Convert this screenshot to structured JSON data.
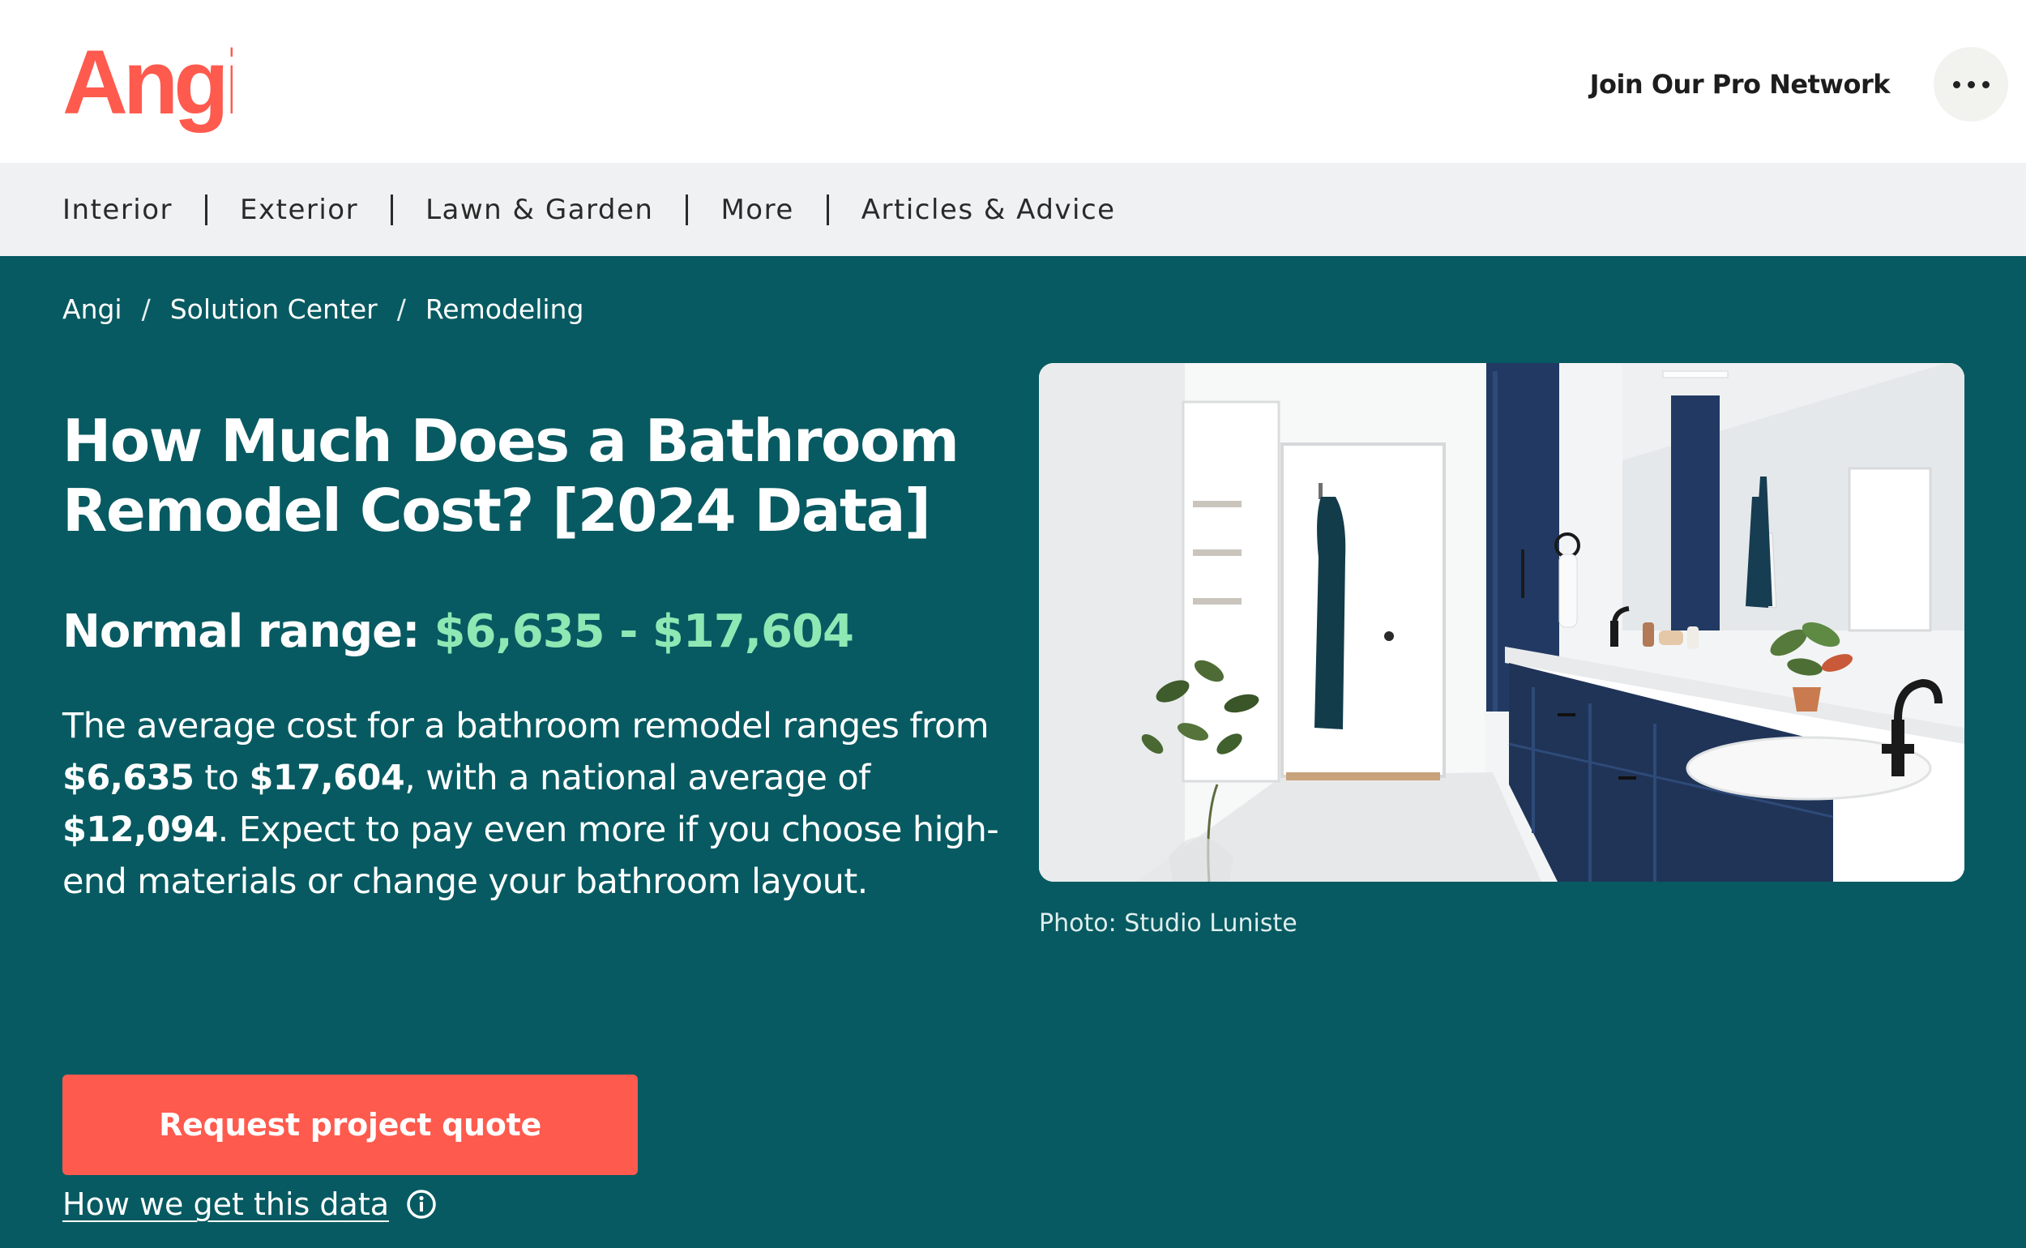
{
  "header": {
    "logo_text": "Angi",
    "pro_network_label": "Join Our Pro Network",
    "brand_color": "#ff5a4e"
  },
  "category_nav": {
    "items": [
      {
        "label": "Interior"
      },
      {
        "label": "Exterior"
      },
      {
        "label": "Lawn & Garden"
      },
      {
        "label": "More"
      },
      {
        "label": "Articles & Advice"
      }
    ]
  },
  "breadcrumb": {
    "items": [
      {
        "label": "Angi"
      },
      {
        "label": "Solution Center"
      },
      {
        "label": "Remodeling"
      }
    ],
    "separator": "/"
  },
  "hero": {
    "background_color": "#075a61",
    "title_line1": "How Much Does a Bathroom",
    "title_line2": "Remodel Cost? [2024 Data]",
    "range_label": "Normal range:",
    "range_value": "$6,635 - $17,604",
    "range_color": "#8ee8b4",
    "summary": {
      "part1": "The average cost for a bathroom remodel ranges from ",
      "low": "$6,635",
      "part2": " to ",
      "high": "$17,604",
      "part3": ", with a national average of ",
      "average": "$12,094",
      "part4": ". Expect to pay even more if you choose high-end materials or change your bathroom layout."
    },
    "data_link_label": "How we get this data",
    "data_link_icon": "info-icon",
    "cta_label": "Request project quote",
    "cta_color": "#ff5a4e",
    "photo_caption": "Photo: Studio Luniste"
  }
}
